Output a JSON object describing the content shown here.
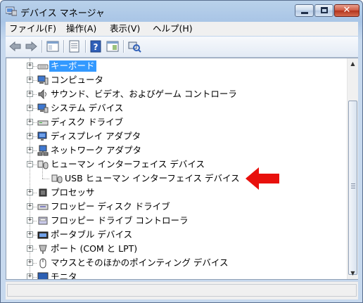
{
  "window": {
    "title": "デバイス マネージャ",
    "close_glyph": "✕"
  },
  "menubar": {
    "items": [
      {
        "label": "ファイル(F)"
      },
      {
        "label": "操作(A)"
      },
      {
        "label": "表示(V)"
      },
      {
        "label": "ヘルプ(H)"
      }
    ]
  },
  "toolbar": {
    "buttons": [
      "back-icon",
      "forward-icon",
      "show-hide-tree-icon",
      "properties-icon",
      "help-icon",
      "refresh-view-icon",
      "scan-hardware-icon"
    ]
  },
  "tree": {
    "items": [
      {
        "label": "キーボード",
        "icon": "keyboard-icon",
        "level": 1,
        "expander": "+",
        "selected": true
      },
      {
        "label": "コンピュータ",
        "icon": "computer-icon",
        "level": 1,
        "expander": "+"
      },
      {
        "label": "サウンド、ビデオ、およびゲーム コントローラ",
        "icon": "speaker-icon",
        "level": 1,
        "expander": "+"
      },
      {
        "label": "システム デバイス",
        "icon": "system-device-icon",
        "level": 1,
        "expander": "+"
      },
      {
        "label": "ディスク ドライブ",
        "icon": "disk-drive-icon",
        "level": 1,
        "expander": "+"
      },
      {
        "label": "ディスプレイ アダプタ",
        "icon": "display-adapter-icon",
        "level": 1,
        "expander": "+"
      },
      {
        "label": "ネットワーク アダプタ",
        "icon": "network-adapter-icon",
        "level": 1,
        "expander": "+"
      },
      {
        "label": "ヒューマン インターフェイス デバイス",
        "icon": "hid-icon",
        "level": 1,
        "expander": "−"
      },
      {
        "label": "USB ヒューマン インターフェイス デバイス",
        "icon": "hid-device-icon",
        "level": 2,
        "expander": ""
      },
      {
        "label": "プロセッサ",
        "icon": "processor-icon",
        "level": 1,
        "expander": "+"
      },
      {
        "label": "フロッピー ディスク ドライブ",
        "icon": "floppy-drive-icon",
        "level": 1,
        "expander": "+"
      },
      {
        "label": "フロッピー ドライブ コントローラ",
        "icon": "floppy-controller-icon",
        "level": 1,
        "expander": "+"
      },
      {
        "label": "ポータブル デバイス",
        "icon": "portable-device-icon",
        "level": 1,
        "expander": "+"
      },
      {
        "label": "ポート (COM と LPT)",
        "icon": "port-icon",
        "level": 1,
        "expander": "+"
      },
      {
        "label": "マウスとそのほかのポインティング デバイス",
        "icon": "mouse-icon",
        "level": 1,
        "expander": "+"
      },
      {
        "label": "モニタ",
        "icon": "monitor-icon",
        "level": 1,
        "expander": "+"
      }
    ]
  },
  "scrollbar": {
    "up_glyph": "▲",
    "down_glyph": "▼"
  },
  "annotation": {
    "arrow_color": "#e8100c"
  },
  "colors": {
    "selection": "#3399ff",
    "title_gradient_top": "#b9d1ea"
  }
}
